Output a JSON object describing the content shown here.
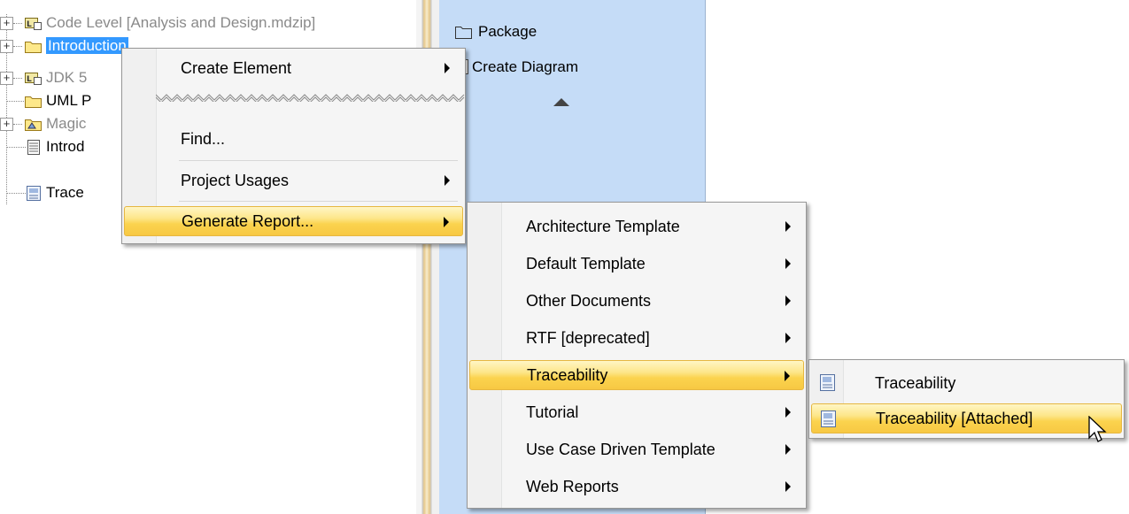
{
  "tree": {
    "items": [
      {
        "label": "Code Level [Analysis and Design.mdzip]",
        "style": "grey",
        "icon": "code-level-package-icon",
        "expandable": true
      },
      {
        "label": "Introduction",
        "style": "selected",
        "icon": "folder-icon",
        "expandable": true
      },
      {
        "label": "JDK 5",
        "style": "grey",
        "icon": "library-package-icon",
        "expandable": true
      },
      {
        "label": "UML P",
        "style": "normal",
        "icon": "folder-icon",
        "expandable": false
      },
      {
        "label": "Magic",
        "style": "grey",
        "icon": "magic-package-icon",
        "expandable": true
      },
      {
        "label": "Introd",
        "style": "normal",
        "icon": "document-icon",
        "expandable": false
      },
      {
        "label": "Trace",
        "style": "normal",
        "icon": "report-icon",
        "expandable": false
      }
    ]
  },
  "right_panel": {
    "package_label": "Package",
    "create_diagram_label": "Create Diagram"
  },
  "context_menu": {
    "items": [
      {
        "label": "Create Element",
        "submenu": true
      },
      {
        "label": "Find...",
        "submenu": false
      },
      {
        "label": "Project Usages",
        "submenu": true
      },
      {
        "label": "Generate Report...",
        "submenu": true,
        "highlighted": true
      }
    ]
  },
  "report_menu": {
    "items": [
      {
        "label": "Architecture Template",
        "submenu": true
      },
      {
        "label": "Default Template",
        "submenu": true
      },
      {
        "label": "Other Documents",
        "submenu": true
      },
      {
        "label": "RTF [deprecated]",
        "submenu": true
      },
      {
        "label": "Traceability",
        "submenu": true,
        "highlighted": true
      },
      {
        "label": "Tutorial",
        "submenu": true
      },
      {
        "label": "Use Case Driven Template",
        "submenu": true
      },
      {
        "label": "Web Reports",
        "submenu": true
      }
    ]
  },
  "traceability_menu": {
    "items": [
      {
        "label": "Traceability",
        "icon": "report-template-icon"
      },
      {
        "label": "Traceability [Attached]",
        "icon": "report-template-icon",
        "highlighted": true
      }
    ]
  },
  "colors": {
    "highlight": "#fbd34e",
    "selection": "#3399ff",
    "panel": "#c5dcf7"
  }
}
